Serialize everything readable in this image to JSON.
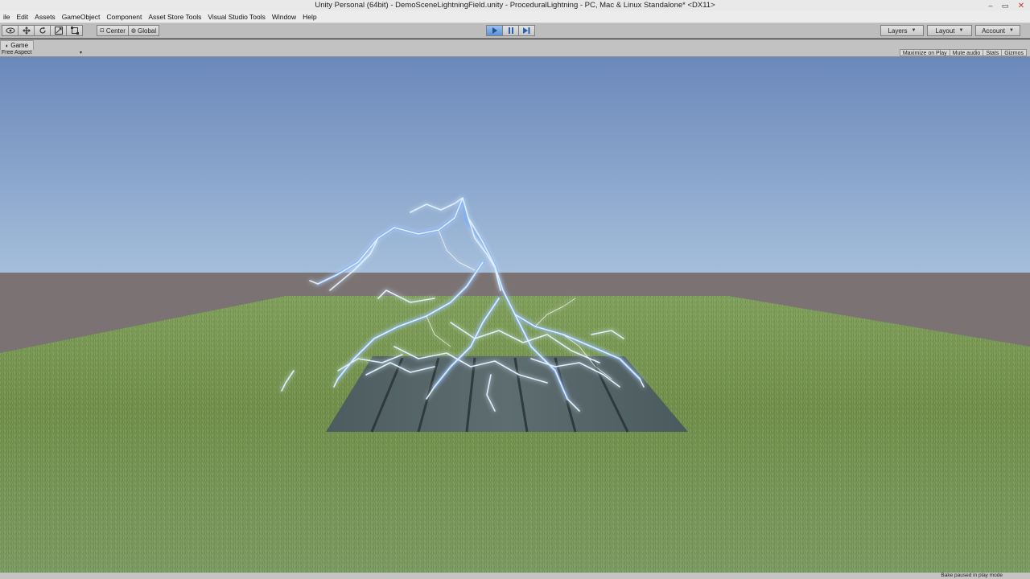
{
  "window": {
    "title": "Unity Personal (64bit) - DemoSceneLightningField.unity - ProceduralLightning - PC, Mac & Linux Standalone* <DX11>",
    "minimize": "–",
    "maximize": "▭",
    "close": "✕"
  },
  "menu": [
    "ile",
    "Edit",
    "Assets",
    "GameObject",
    "Component",
    "Asset Store Tools",
    "Visual Studio Tools",
    "Window",
    "Help"
  ],
  "toolbar": {
    "center_label": "Center",
    "global_label": "Global",
    "layers_label": "Layers",
    "layout_label": "Layout",
    "account_label": "Account",
    "play_active": true
  },
  "game_view": {
    "tab_label": "Game",
    "aspect_label": "Free Aspect",
    "maximize_on_play": "Maximize on Play",
    "mute_audio": "Mute audio",
    "stats": "Stats",
    "gizmos": "Gizmos"
  },
  "status": {
    "message": "Bake paused in play mode"
  },
  "colors": {
    "sky_top": "#6f8fc0",
    "sky_horizon": "#f2f7fb",
    "ground_far": "#777072",
    "grass": "#6f8f49",
    "lightning": "#cfe7ff",
    "lightning_glow": "#6ea8ff",
    "play_active": "#5d91d8"
  }
}
